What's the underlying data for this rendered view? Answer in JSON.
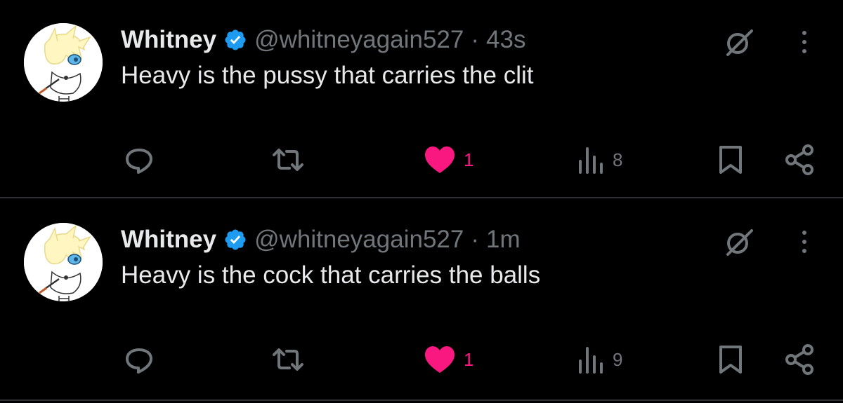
{
  "colors": {
    "background": "#000000",
    "primary_text": "#e7e9ea",
    "secondary_text": "#71767b",
    "like_active": "#f91880",
    "verified_badge": "#1d9bf0",
    "divider": "#2f3336"
  },
  "tweets": [
    {
      "display_name": "Whitney",
      "handle": "@whitneyagain527",
      "separator": "·",
      "time": "43s",
      "text": "Heavy is the pussy that carries the clit",
      "actions": {
        "reply_icon": "reply-icon",
        "retweet_icon": "retweet-icon",
        "like_icon": "heart-filled-icon",
        "like_count": "1",
        "views_icon": "views-icon",
        "views_count": "8",
        "bookmark_icon": "bookmark-icon",
        "share_icon": "share-icon"
      }
    },
    {
      "display_name": "Whitney",
      "handle": "@whitneyagain527",
      "separator": "·",
      "time": "1m",
      "text": "Heavy is the cock that carries the balls",
      "actions": {
        "reply_icon": "reply-icon",
        "retweet_icon": "retweet-icon",
        "like_icon": "heart-filled-icon",
        "like_count": "1",
        "views_icon": "views-icon",
        "views_count": "9",
        "bookmark_icon": "bookmark-icon",
        "share_icon": "share-icon"
      }
    }
  ]
}
